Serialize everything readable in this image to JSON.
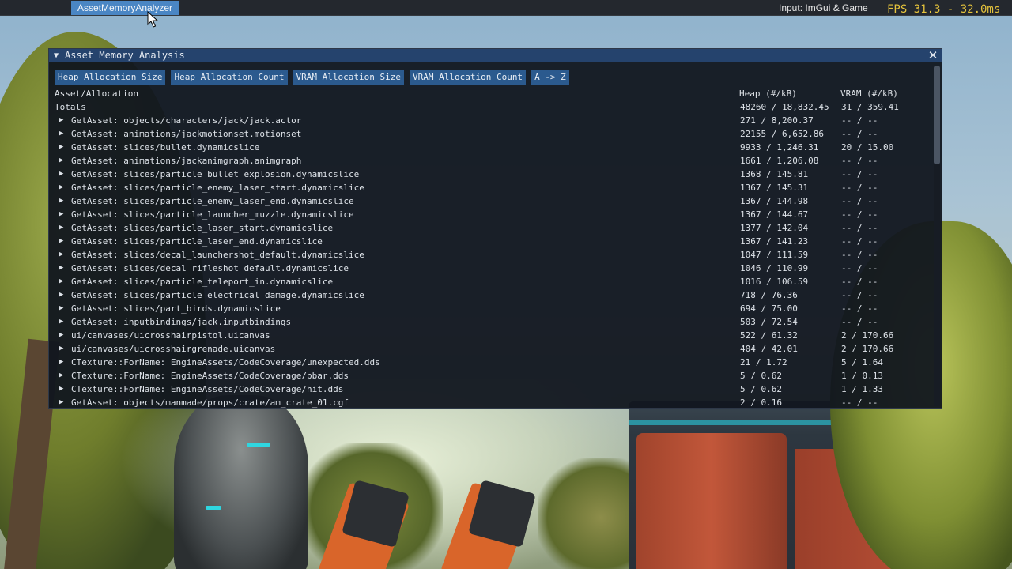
{
  "menubar": {
    "menu_label": "AssetMemoryAnalyzer",
    "input_mode": "Input: ImGui & Game",
    "fps": "FPS 31.3 - 32.0ms"
  },
  "window": {
    "title": "Asset Memory Analysis",
    "buttons": [
      "Heap Allocation Size",
      "Heap Allocation Count",
      "VRAM Allocation Size",
      "VRAM Allocation Count",
      "A -> Z"
    ],
    "headers": {
      "name": "Asset/Allocation",
      "heap": "Heap (#/kB)",
      "vram": "VRAM (#/kB)"
    },
    "totals": {
      "name": "Totals",
      "heap": "48260 / 18,832.45",
      "vram": "31 / 359.41"
    },
    "rows": [
      {
        "name": "GetAsset: objects/characters/jack/jack.actor",
        "heap": "271 / 8,200.37",
        "vram": "-- / --"
      },
      {
        "name": "GetAsset: animations/jackmotionset.motionset",
        "heap": "22155 / 6,652.86",
        "vram": "-- / --"
      },
      {
        "name": "GetAsset: slices/bullet.dynamicslice",
        "heap": "9933 / 1,246.31",
        "vram": "20 / 15.00"
      },
      {
        "name": "GetAsset: animations/jackanimgraph.animgraph",
        "heap": "1661 / 1,206.08",
        "vram": "-- / --"
      },
      {
        "name": "GetAsset: slices/particle_bullet_explosion.dynamicslice",
        "heap": "1368 / 145.81",
        "vram": "-- / --"
      },
      {
        "name": "GetAsset: slices/particle_enemy_laser_start.dynamicslice",
        "heap": "1367 / 145.31",
        "vram": "-- / --"
      },
      {
        "name": "GetAsset: slices/particle_enemy_laser_end.dynamicslice",
        "heap": "1367 / 144.98",
        "vram": "-- / --"
      },
      {
        "name": "GetAsset: slices/particle_launcher_muzzle.dynamicslice",
        "heap": "1367 / 144.67",
        "vram": "-- / --"
      },
      {
        "name": "GetAsset: slices/particle_laser_start.dynamicslice",
        "heap": "1377 / 142.04",
        "vram": "-- / --"
      },
      {
        "name": "GetAsset: slices/particle_laser_end.dynamicslice",
        "heap": "1367 / 141.23",
        "vram": "-- / --"
      },
      {
        "name": "GetAsset: slices/decal_launchershot_default.dynamicslice",
        "heap": "1047 / 111.59",
        "vram": "-- / --"
      },
      {
        "name": "GetAsset: slices/decal_rifleshot_default.dynamicslice",
        "heap": "1046 / 110.99",
        "vram": "-- / --"
      },
      {
        "name": "GetAsset: slices/particle_teleport_in.dynamicslice",
        "heap": "1016 / 106.59",
        "vram": "-- / --"
      },
      {
        "name": "GetAsset: slices/particle_electrical_damage.dynamicslice",
        "heap": "718 / 76.36",
        "vram": "-- / --"
      },
      {
        "name": "GetAsset: slices/part_birds.dynamicslice",
        "heap": "694 / 75.00",
        "vram": "-- / --"
      },
      {
        "name": "GetAsset: inputbindings/jack.inputbindings",
        "heap": "503 / 72.54",
        "vram": "-- / --"
      },
      {
        "name": "ui/canvases/uicrosshairpistol.uicanvas",
        "heap": "522 / 61.32",
        "vram": "2 / 170.66"
      },
      {
        "name": "ui/canvases/uicrosshairgrenade.uicanvas",
        "heap": "404 / 42.01",
        "vram": "2 / 170.66"
      },
      {
        "name": "CTexture::ForName: EngineAssets/CodeCoverage/unexpected.dds",
        "heap": "21 / 1.72",
        "vram": "5 / 1.64"
      },
      {
        "name": "CTexture::ForName: EngineAssets/CodeCoverage/pbar.dds",
        "heap": "5 / 0.62",
        "vram": "1 / 0.13"
      },
      {
        "name": "CTexture::ForName: EngineAssets/CodeCoverage/hit.dds",
        "heap": "5 / 0.62",
        "vram": "1 / 1.33"
      },
      {
        "name": "GetAsset: objects/manmade/props/crate/am_crate_01.cgf",
        "heap": "2 / 0.16",
        "vram": "-- / --"
      }
    ]
  },
  "colors": {
    "menu_highlight": "#4a86c4",
    "title_bar": "#25436d",
    "button": "#2b5a8e",
    "fps_text": "#e5c33c"
  },
  "icons": {
    "collapse": "triangle-down-icon",
    "close": "close-icon",
    "expand": "triangle-right-icon",
    "cursor": "mouse-cursor-icon"
  }
}
